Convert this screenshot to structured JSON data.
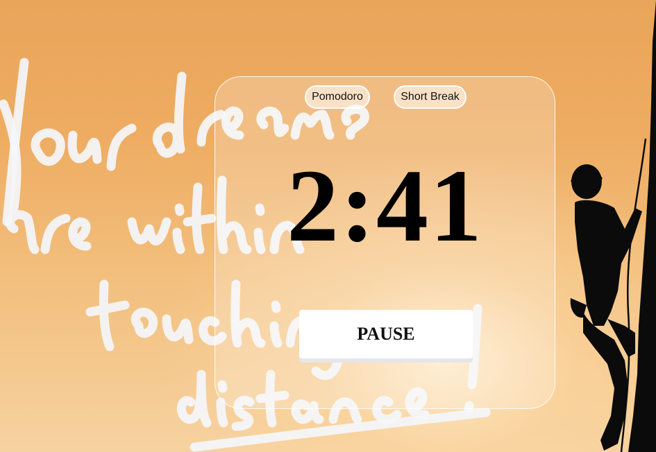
{
  "background": {
    "quote": "Your dreams are within touching distance!",
    "colors": {
      "sky_top": "#e9a55a",
      "sky_glow": "#fbe6c8",
      "silhouette": "#0b0b0b",
      "script": "#f4f6fb"
    }
  },
  "tabs": [
    {
      "label": "Pomodoro"
    },
    {
      "label": "Short Break"
    }
  ],
  "timer": {
    "display": "2:41"
  },
  "controls": {
    "pause_label": "PAUSE"
  }
}
